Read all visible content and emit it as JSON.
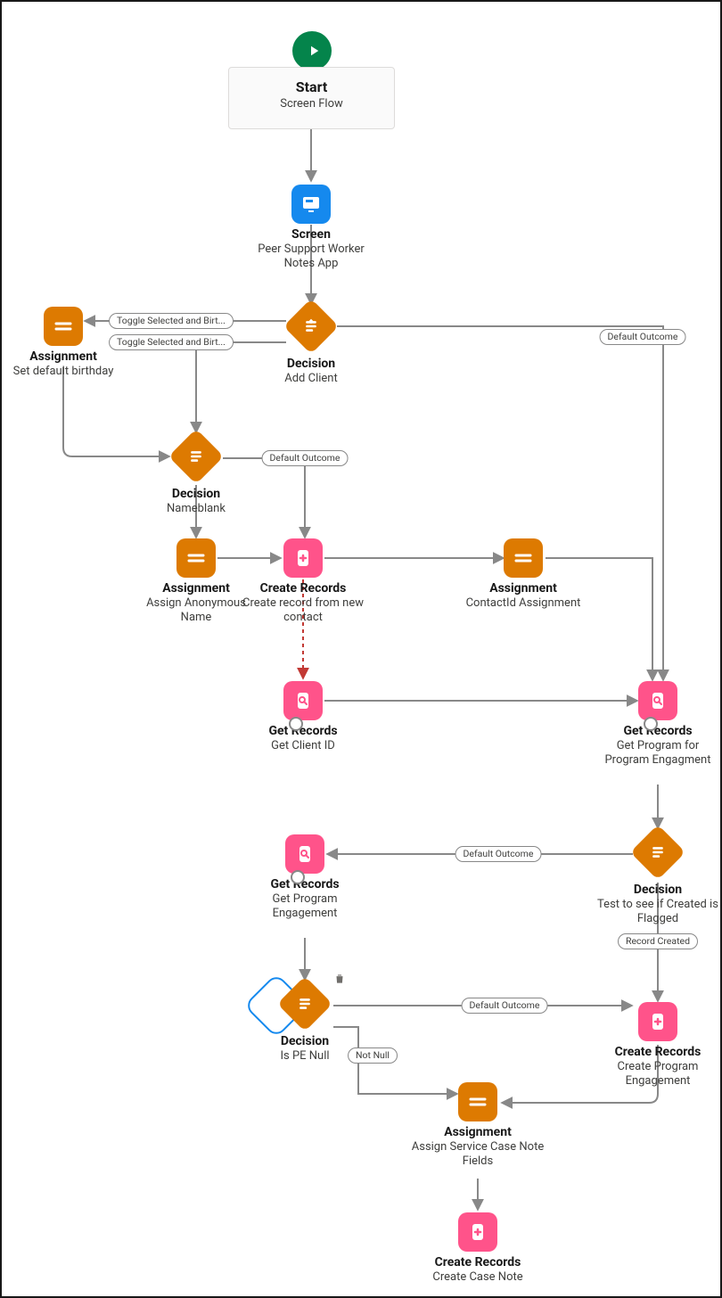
{
  "start": {
    "title": "Start",
    "subtitle": "Screen Flow"
  },
  "screen": {
    "title": "Screen",
    "subtitle": "Peer Support Worker Notes App"
  },
  "dec_addclient": {
    "title": "Decision",
    "subtitle": "Add Client"
  },
  "asg_birthday": {
    "title": "Assignment",
    "subtitle": "Set default birthday"
  },
  "dec_nameblank": {
    "title": "Decision",
    "subtitle": "Nameblank"
  },
  "asg_anon": {
    "title": "Assignment",
    "subtitle": "Assign Anonymous Name"
  },
  "create_contact": {
    "title": "Create Records",
    "subtitle": "Create record from new contact"
  },
  "asg_contactid": {
    "title": "Assignment",
    "subtitle": "ContactId Assignment"
  },
  "get_clientid": {
    "title": "Get Records",
    "subtitle": "Get Client ID"
  },
  "get_program_pe": {
    "title": "Get Records",
    "subtitle": "Get Program for Program Engagment"
  },
  "dec_created": {
    "title": "Decision",
    "subtitle": "Test to see if Created is Flagged"
  },
  "get_pe": {
    "title": "Get Records",
    "subtitle": "Get Program Engagement"
  },
  "create_pe": {
    "title": "Create Records",
    "subtitle": "Create Program Engagement"
  },
  "dec_penull": {
    "title": "Decision",
    "subtitle": "Is PE Null"
  },
  "asg_service": {
    "title": "Assignment",
    "subtitle": "Assign Service Case Note Fields"
  },
  "create_case": {
    "title": "Create Records",
    "subtitle": "Create Case Note"
  },
  "pills": {
    "toggle1": "Toggle Selected and Birt...",
    "toggle2": "Toggle Selected and Birt...",
    "default": "Default Outcome",
    "record_created": "Record Created",
    "not_null": "Not Null"
  }
}
